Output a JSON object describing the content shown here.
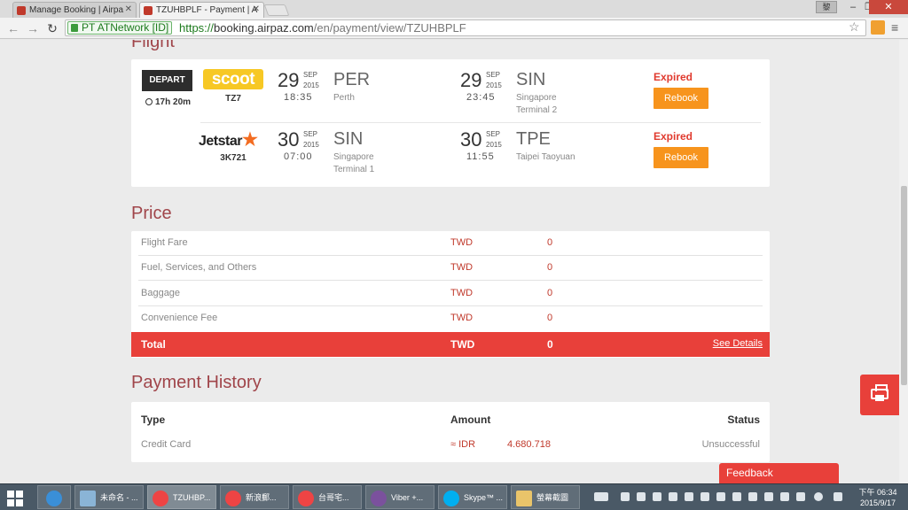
{
  "browser": {
    "tabs": [
      {
        "title": "Manage Booking | Airpa",
        "close": "✕"
      },
      {
        "title": "TZUHBPLF - Payment | A",
        "close": "✕"
      }
    ],
    "user_badge": "黎",
    "window_controls": {
      "minimize": "–",
      "restore": "❐",
      "close": "✕"
    },
    "security_label": "PT ATNetwork [ID]",
    "url_scheme": "https://",
    "url_host": "booking.airpaz.com",
    "url_path": "/en/payment/view/TZUHBPLF",
    "icons": {
      "back": "←",
      "forward": "→",
      "reload": "↻",
      "bookmark": "☆",
      "menu": "≡"
    }
  },
  "flight": {
    "section_title": "Flight",
    "depart_label": "DEPART",
    "duration": "17h 20m",
    "segments": [
      {
        "airline_logo_text": "scoot",
        "flight_code": "TZ7",
        "dep_day": "29",
        "dep_month": "SEP",
        "dep_year": "2015",
        "dep_time": "18:35",
        "dep_code": "PER",
        "dep_city": "Perth",
        "dep_terminal": "",
        "arr_day": "29",
        "arr_month": "SEP",
        "arr_year": "2015",
        "arr_time": "23:45",
        "arr_code": "SIN",
        "arr_city": "Singapore",
        "arr_terminal": "Terminal 2",
        "status": "Expired",
        "action": "Rebook"
      },
      {
        "airline_logo_text": "Jetstar",
        "flight_code": "3K721",
        "dep_day": "30",
        "dep_month": "SEP",
        "dep_year": "2015",
        "dep_time": "07:00",
        "dep_code": "SIN",
        "dep_city": "Singapore",
        "dep_terminal": "Terminal 1",
        "arr_day": "30",
        "arr_month": "SEP",
        "arr_year": "2015",
        "arr_time": "11:55",
        "arr_code": "TPE",
        "arr_city": "Taipei Taoyuan",
        "arr_terminal": "",
        "status": "Expired",
        "action": "Rebook"
      }
    ]
  },
  "price": {
    "section_title": "Price",
    "rows": [
      {
        "label": "Flight Fare",
        "currency": "TWD",
        "amount": "0"
      },
      {
        "label": "Fuel, Services, and Others",
        "currency": "TWD",
        "amount": "0"
      },
      {
        "label": "Baggage",
        "currency": "TWD",
        "amount": "0"
      },
      {
        "label": "Convenience Fee",
        "currency": "TWD",
        "amount": "0"
      }
    ],
    "total": {
      "label": "Total",
      "currency": "TWD",
      "amount": "0",
      "link": "See Details"
    }
  },
  "payment_history": {
    "section_title": "Payment History",
    "headers": {
      "type": "Type",
      "amount": "Amount",
      "status": "Status"
    },
    "rows": [
      {
        "type": "Credit Card",
        "currency": "≈ IDR",
        "amount": "4.680.718",
        "status": "Unsuccessful"
      }
    ]
  },
  "feedback_label": "Feedback",
  "taskbar": {
    "items": [
      {
        "label": "未命名 - ..."
      },
      {
        "label": "TZUHBP..."
      },
      {
        "label": "新浪郵..."
      },
      {
        "label": "台哥宅..."
      },
      {
        "label": "Viber +..."
      },
      {
        "label": "Skype™ ..."
      },
      {
        "label": "螢幕截圖"
      }
    ],
    "clock_time": "下午 06:34",
    "clock_date": "2015/9/17"
  },
  "colors": {
    "brand_red": "#e8403a",
    "orange": "#f7941d",
    "section_title": "#a0454a"
  }
}
